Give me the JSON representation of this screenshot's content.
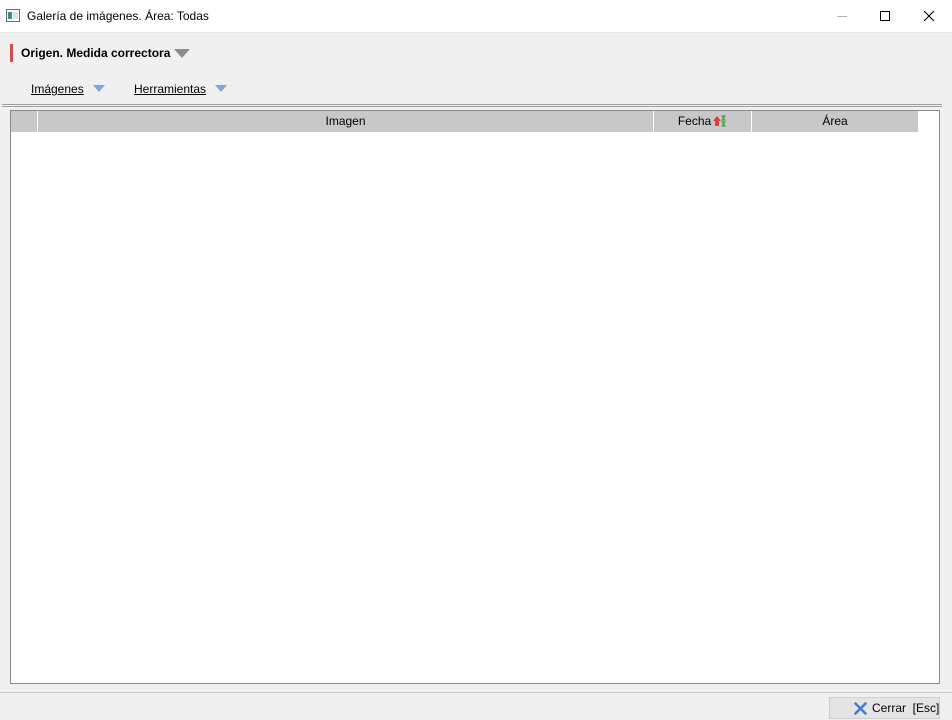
{
  "window": {
    "title": "Galería de imágenes. Área: Todas",
    "icon": "app-window-icon",
    "controls": [
      "minimize-icon",
      "maximize-icon",
      "close-icon"
    ]
  },
  "origin": {
    "label": "Origen. Medida correctora",
    "accent_color": "#d34b4b",
    "dropdown_icon": "triangle-down-icon"
  },
  "menu": {
    "items": [
      {
        "label": "Imágenes",
        "icon": "triangle-down-icon"
      },
      {
        "label": "Herramientas",
        "icon": "triangle-down-icon"
      }
    ],
    "arrow_color": "#7aa6e0"
  },
  "grid": {
    "columns": [
      {
        "label": ""
      },
      {
        "label": "Imagen"
      },
      {
        "label": "Fecha",
        "sort_icon": "sort-ascending-icon"
      },
      {
        "label": "Área"
      }
    ],
    "rows": [],
    "header_color": "#c8c8c8"
  },
  "footer": {
    "close_button": {
      "label": "Cerrar  [Esc]",
      "icon": "x-close-icon",
      "icon_color": "#3d7fd6"
    }
  }
}
